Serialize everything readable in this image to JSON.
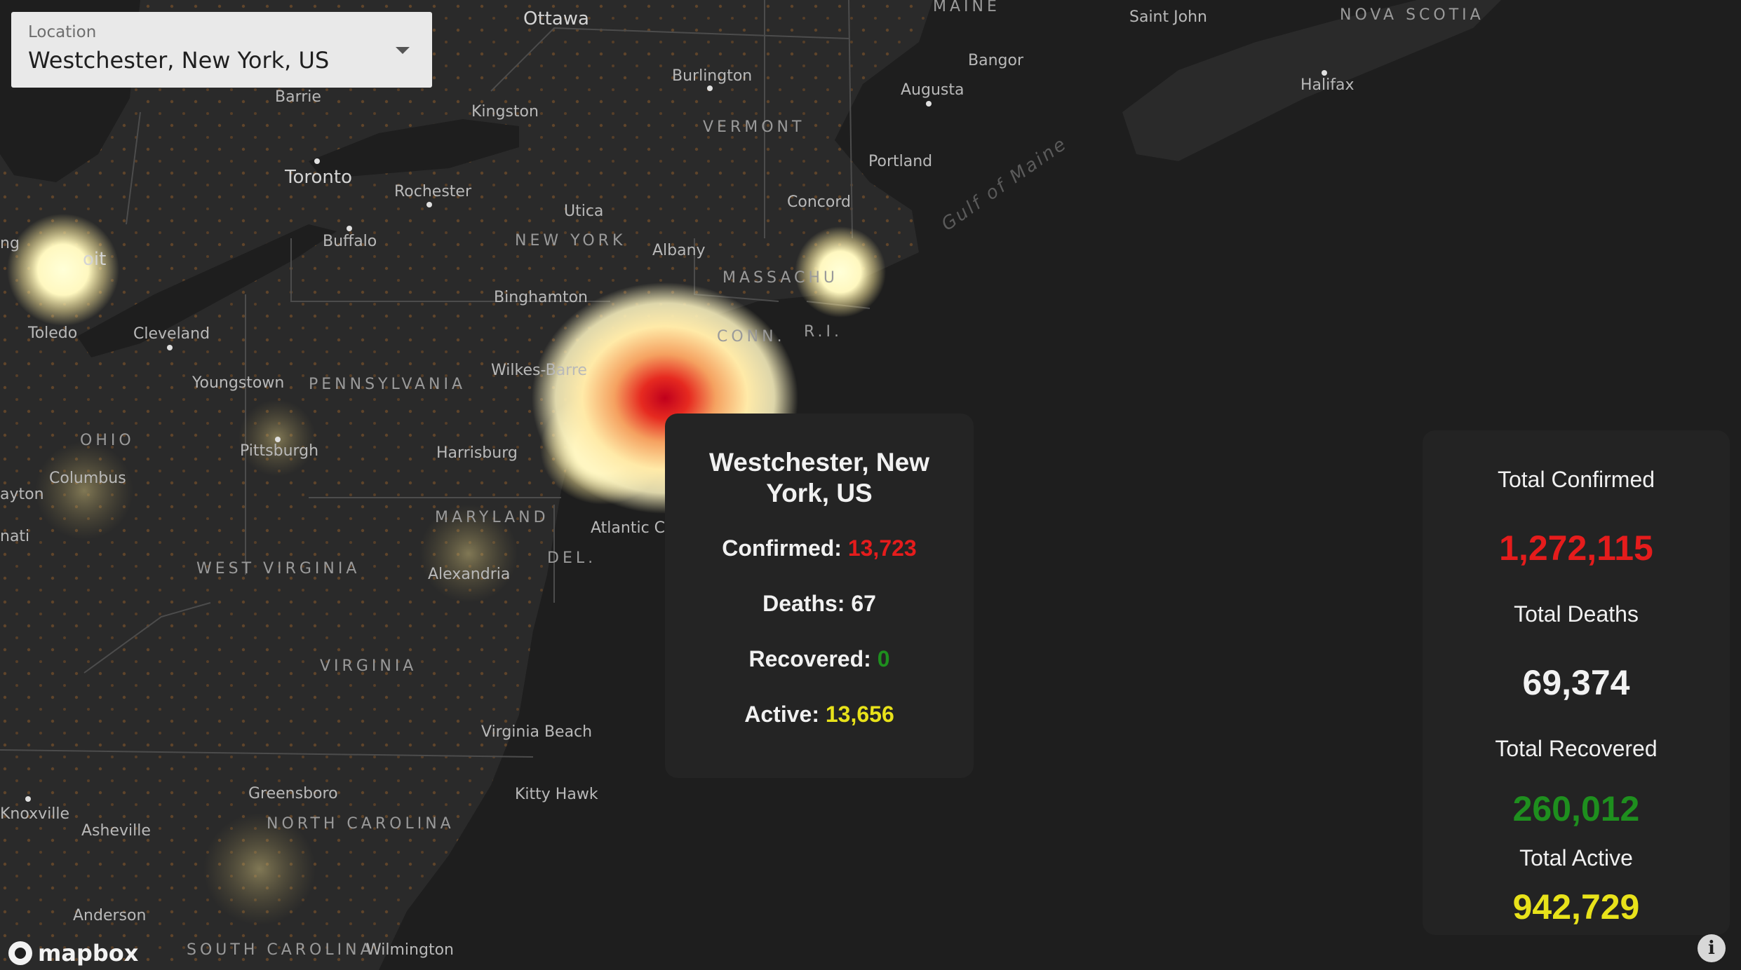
{
  "location_select": {
    "label": "Location",
    "value": "Westchester, New York, US"
  },
  "map": {
    "places": [
      "Ottawa",
      "Saint John",
      "Bangor",
      "Burlington",
      "Halifax",
      "Augusta",
      "Barrie",
      "Kingston",
      "Toronto",
      "Rochester",
      "Portland",
      "Concord",
      "Utica",
      "Buffalo",
      "Albany",
      "Binghamton",
      "Toledo",
      "Cleveland",
      "Youngstown",
      "Wilkes-Barre",
      "Pittsburgh",
      "Harrisburg",
      "Columbus",
      "Atlantic Ci",
      "Alexandria",
      "Virginia Beach",
      "Greensboro",
      "Kitty Hawk",
      "Knoxville",
      "Asheville",
      "Anderson",
      "Wilmington",
      "ng",
      "oit",
      "ayton",
      "nati"
    ],
    "regions": [
      "MAINE",
      "NOVA SCOTIA",
      "VERMONT",
      "NEW YORK",
      "MASSACHU",
      "CONN.",
      "R.I.",
      "PENNSYLVANIA",
      "OHIO",
      "MARYLAND",
      "DEL.",
      "WEST VIRGINIA",
      "VIRGINIA",
      "NORTH CAROLINA",
      "SOUTH CAROLINA"
    ],
    "water": [
      "Gulf of Maine"
    ]
  },
  "popup": {
    "title": "Westchester, New York, US",
    "confirmed_label": "Confirmed:",
    "confirmed_value": "13,723",
    "deaths_label": "Deaths:",
    "deaths_value": "67",
    "recovered_label": "Recovered:",
    "recovered_value": "0",
    "active_label": "Active:",
    "active_value": "13,656"
  },
  "totals": {
    "confirmed_label": "Total Confirmed",
    "confirmed_value": "1,272,115",
    "deaths_label": "Total Deaths",
    "deaths_value": "69,374",
    "recovered_label": "Total Recovered",
    "recovered_value": "260,012",
    "active_label": "Total Active",
    "active_value": "942,729"
  },
  "colors": {
    "confirmed": "#e51c1c",
    "deaths": "#f2f2f2",
    "recovered": "#1e8f1e",
    "active": "#e8e21a",
    "land": "#2c2c2c",
    "water": "#1e1e1e"
  },
  "attribution": {
    "logo_text": "mapbox",
    "info_icon": "info-icon"
  }
}
